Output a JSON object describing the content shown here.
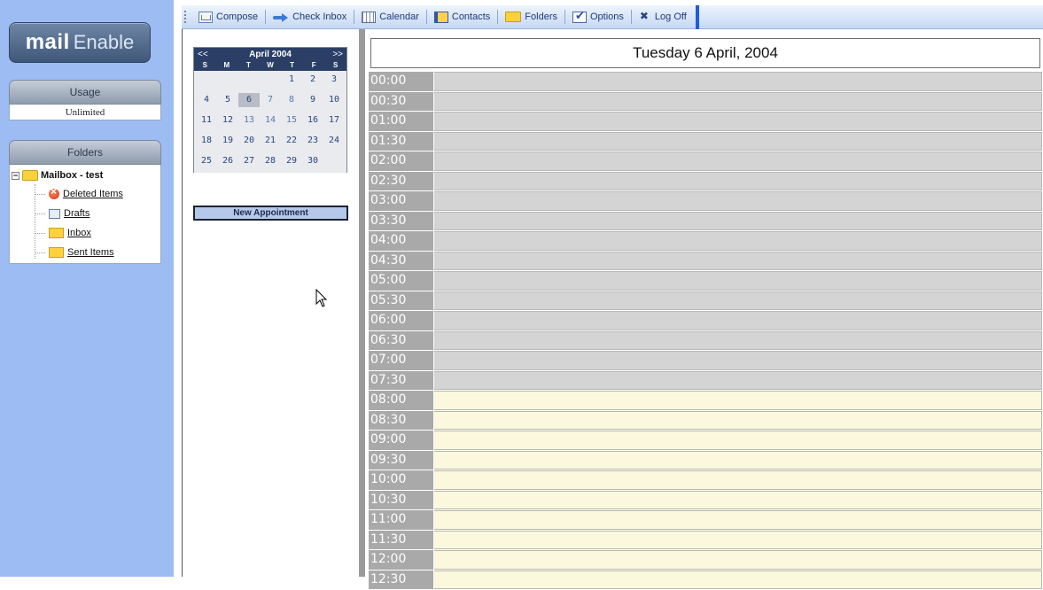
{
  "brand": {
    "logo_bold": "mail",
    "logo_light": "Enable"
  },
  "toolbar": {
    "items": [
      {
        "label": "Compose",
        "icon": "compose-icon"
      },
      {
        "label": "Check Inbox",
        "icon": "check-inbox-icon"
      },
      {
        "label": "Calendar",
        "icon": "calendar-icon"
      },
      {
        "label": "Contacts",
        "icon": "contacts-icon"
      },
      {
        "label": "Folders",
        "icon": "folder-icon"
      },
      {
        "label": "Options",
        "icon": "options-icon"
      },
      {
        "label": "Log Off",
        "icon": "log-off-icon"
      }
    ]
  },
  "usage": {
    "title": "Usage",
    "value": "Unlimited"
  },
  "folders": {
    "title": "Folders",
    "root": "Mailbox - test",
    "items": [
      {
        "label": "Deleted Items",
        "icon": "deleted-items-icon"
      },
      {
        "label": "Drafts",
        "icon": "drafts-icon"
      },
      {
        "label": "Inbox",
        "icon": "folder-icon"
      },
      {
        "label": "Sent Items",
        "icon": "folder-icon"
      }
    ]
  },
  "minical": {
    "prev": "<<",
    "next": ">>",
    "month": "April 2004",
    "dow": [
      "S",
      "M",
      "T",
      "W",
      "T",
      "F",
      "S"
    ],
    "days": [
      "",
      "",
      "",
      "",
      "1",
      "2",
      "3",
      "4",
      "5",
      "6",
      "7",
      "8",
      "9",
      "10",
      "11",
      "12",
      "13",
      "14",
      "15",
      "16",
      "17",
      "18",
      "19",
      "20",
      "21",
      "22",
      "23",
      "24",
      "25",
      "26",
      "27",
      "28",
      "29",
      "30",
      ""
    ],
    "today": "6"
  },
  "new_appointment_label": "New Appointment",
  "day_view": {
    "title": "Tuesday 6 April, 2004",
    "slots": [
      "00:00",
      "00:30",
      "01:00",
      "01:30",
      "02:00",
      "02:30",
      "03:00",
      "03:30",
      "04:00",
      "04:30",
      "05:00",
      "05:30",
      "06:00",
      "06:30",
      "07:00",
      "07:30",
      "08:00",
      "08:30",
      "09:00",
      "09:30",
      "10:00",
      "10:30",
      "11:00",
      "11:30",
      "12:00",
      "12:30"
    ],
    "work_start": "08:00"
  }
}
